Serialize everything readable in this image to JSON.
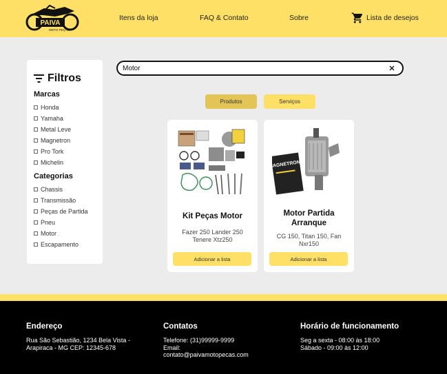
{
  "header": {
    "logo": {
      "name": "PAIVA",
      "tagline": "MOTO PEÇAS"
    },
    "nav": [
      "Itens da loja",
      "FAQ & Contato",
      "Sobre"
    ],
    "wishlist_label": "Lista de desejos"
  },
  "filters": {
    "title": "Filtros",
    "brands_title": "Marcas",
    "brands": [
      "Honda",
      "Yamaha",
      "Metal Leve",
      "Magnetron",
      "Pro Tork",
      "Michelin"
    ],
    "categories_title": "Categorias",
    "categories": [
      "Chassis",
      "Transmissão",
      "Peças de Partida",
      "Pneu",
      "Motor",
      "Escapamento"
    ]
  },
  "search": {
    "value": "Motor"
  },
  "tabs": {
    "products": "Produtos",
    "services": "Serviços"
  },
  "products": [
    {
      "title": "Kit Peças Motor",
      "desc": "Fazer 250 Lander 250 Tenere Xtz250",
      "button": "Adicionar a lista"
    },
    {
      "title": "Motor Partida Arranque",
      "desc": "CG 150, Titan 150, Fan Nxr150",
      "button": "Adicionar a lista",
      "image_brand": "MAGNETRON"
    }
  ],
  "footer": {
    "address_title": "Endereço",
    "address": "Rua São Sebastião, 1234 Bela Vista - Arapiraca - MG CEP: 12345-678",
    "contacts_title": "Contatos",
    "phone": "Telefone: (31)99999-9999",
    "email_label": "Email:",
    "email": "contato@paivamotopecas.com",
    "hours_title": "Horário de funcionamento",
    "hours_weekdays": "Seg a sexta - 08:00 às 18:00",
    "hours_saturday": "Sábado - 09:00 às 12:00"
  },
  "colors": {
    "accent": "#ffe066",
    "accent_dark": "#e2c556",
    "footer_bg": "#000000",
    "page_bg": "#ececec"
  }
}
